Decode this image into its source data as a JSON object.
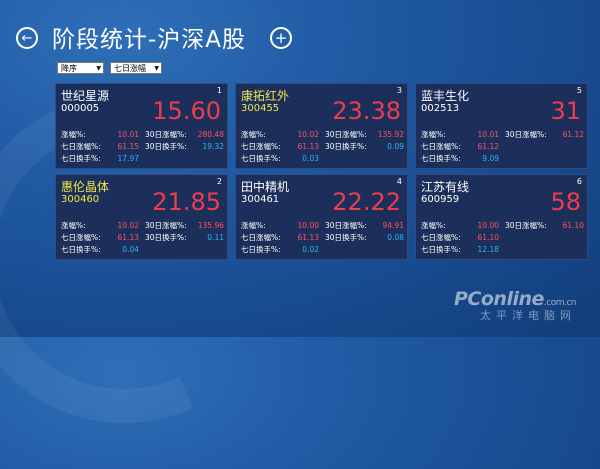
{
  "header": {
    "title": "阶段统计-沪深A股",
    "back_icon": "←",
    "add_icon": "+"
  },
  "filters": {
    "sort_value": "降序",
    "range_value": "七日涨幅"
  },
  "labels": {
    "change": "涨幅%:",
    "change7": "七日涨幅%:",
    "turnover7": "七日换手%:",
    "change30": "30日涨幅%:",
    "turnover30": "30日换手%:"
  },
  "cards": [
    {
      "rank": "1",
      "name": "世纪星源",
      "code": "000005",
      "price": "15.60",
      "highlight": false,
      "change": "10.01",
      "change7": "61.15",
      "turnover7": "17.97",
      "change30": "280.48",
      "turnover30": "19.32"
    },
    {
      "rank": "3",
      "name": "康拓红外",
      "code": "300455",
      "price": "23.38",
      "highlight": true,
      "change": "10.02",
      "change7": "61.13",
      "turnover7": "0.03",
      "change30": "135.92",
      "turnover30": "0.09"
    },
    {
      "rank": "5",
      "name": "蓝丰生化",
      "code": "002513",
      "price": "31",
      "highlight": false,
      "change": "10.01",
      "change7": "61.12",
      "turnover7": "9.09",
      "change30": "61.12",
      "turnover30": ""
    },
    {
      "rank": "2",
      "name": "惠伦晶体",
      "code": "300460",
      "price": "21.85",
      "highlight": true,
      "change": "10.02",
      "change7": "61.13",
      "turnover7": "0.04",
      "change30": "135.96",
      "turnover30": "0.11"
    },
    {
      "rank": "4",
      "name": "田中精机",
      "code": "300461",
      "price": "22.22",
      "highlight": false,
      "change": "10.00",
      "change7": "61.13",
      "turnover7": "0.02",
      "change30": "94.91",
      "turnover30": "0.08"
    },
    {
      "rank": "6",
      "name": "江苏有线",
      "code": "600959",
      "price": "58",
      "highlight": false,
      "change": "10.00",
      "change7": "61.10",
      "turnover7": "12.18",
      "change30": "61.10",
      "turnover30": ""
    }
  ],
  "watermark": {
    "logo": "PConline",
    "domain": ".com.cn",
    "subtitle": "太平洋电脑网"
  }
}
